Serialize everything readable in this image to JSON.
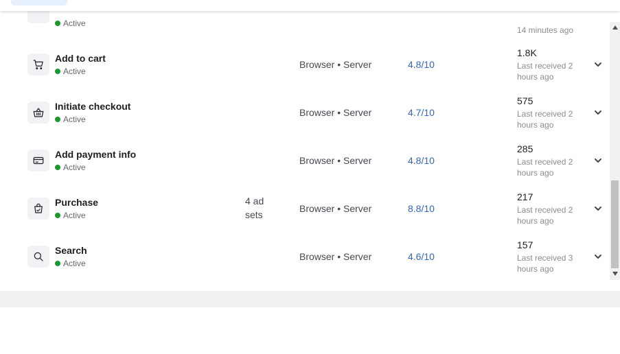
{
  "partial_row": {
    "status": "Active",
    "received": "14 minutes ago"
  },
  "events": [
    {
      "name": "Add to cart",
      "icon": "cart-icon",
      "status": "Active",
      "ad_sets": "",
      "integration": "Browser • Server",
      "quality": "4.8/10",
      "count": "1.8K",
      "received": "Last received 2 hours ago"
    },
    {
      "name": "Initiate checkout",
      "icon": "basket-icon",
      "status": "Active",
      "ad_sets": "",
      "integration": "Browser • Server",
      "quality": "4.7/10",
      "count": "575",
      "received": "Last received 2 hours ago"
    },
    {
      "name": "Add payment info",
      "icon": "credit-card-icon",
      "status": "Active",
      "ad_sets": "",
      "integration": "Browser • Server",
      "quality": "4.8/10",
      "count": "285",
      "received": "Last received 2 hours ago"
    },
    {
      "name": "Purchase",
      "icon": "shopping-bag-icon",
      "status": "Active",
      "ad_sets": "4 ad sets",
      "integration": "Browser • Server",
      "quality": "8.8/10",
      "count": "217",
      "received": "Last received 2 hours ago"
    },
    {
      "name": "Search",
      "icon": "search-icon",
      "status": "Active",
      "ad_sets": "",
      "integration": "Browser • Server",
      "quality": "4.6/10",
      "count": "157",
      "received": "Last received 3 hours ago"
    }
  ],
  "colors": {
    "active": "#1a9a2e",
    "link": "#2f65c8"
  }
}
